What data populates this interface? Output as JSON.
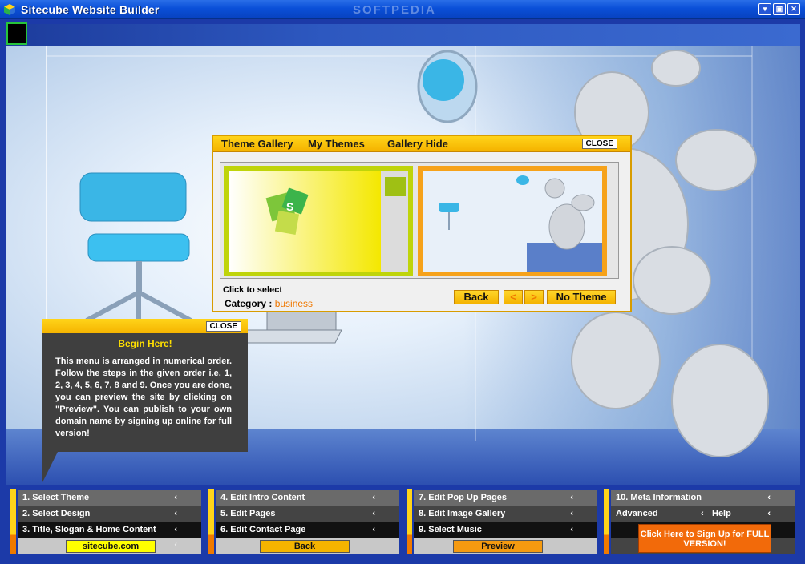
{
  "window": {
    "title": "Sitecube Website Builder",
    "watermark": "SOFTPEDIA",
    "controls": [
      "▾",
      "▣",
      "✕"
    ]
  },
  "gallery": {
    "tabs": [
      "Theme Gallery",
      "My Themes",
      "Gallery Hide"
    ],
    "close_label": "CLOSE",
    "click_hint": "Click to select",
    "category_label": "Category :",
    "category_value": "business",
    "back_label": "Back",
    "prev_label": "<",
    "next_label": ">",
    "no_theme_label": "No Theme"
  },
  "begin": {
    "close_label": "CLOSE",
    "title": "Begin Here!",
    "text": "This menu is arranged in numerical order. Follow the steps in the given order i.e, 1, 2, 3, 4, 5, 6, 7, 8 and 9. Once you are done, you can preview the site by clicking on \"Preview\". You can publish to your own domain name by signing up online for full version!"
  },
  "menu": {
    "panel1": {
      "rows": [
        "1.  Select Theme",
        "2. Select Design",
        "3. Title, Slogan & Home Content"
      ],
      "foot_label": "sitecube.com"
    },
    "panel2": {
      "rows": [
        "4. Edit Intro Content",
        "5.  Edit Pages",
        "6.  Edit Contact Page"
      ],
      "foot_label": "Back"
    },
    "panel3": {
      "rows": [
        "7.  Edit Pop Up Pages",
        "8.  Edit Image Gallery",
        "9.  Select Music"
      ],
      "foot_label": "Preview"
    },
    "panel4": {
      "rows": [
        "10. Meta Information",
        "Advanced",
        "Help"
      ],
      "signup_label": "Click Here to Sign Up for FULL VERSION!"
    },
    "chevron": "‹"
  },
  "colors": {
    "accent_yellow": "#f5b400",
    "accent_orange": "#f07800",
    "titlebar_blue": "#0a4fd8"
  }
}
